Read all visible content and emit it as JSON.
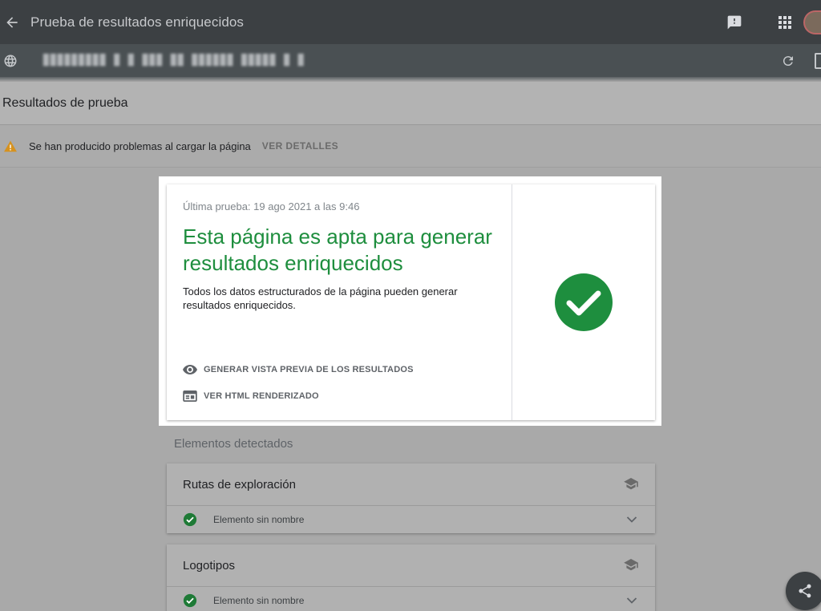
{
  "app": {
    "title": "Prueba de resultados enriquecidos",
    "url": "▉▉▉▉▉▉▉▉▉ ▉ ▉ ▉▉▉ ▉▉ ▉▉▉▉▉▉ ▉▉▉▉▉ ▉ ▉"
  },
  "results": {
    "header": "Resultados de prueba",
    "warning_text": "Se han producido problemas al cargar la página",
    "warning_link": "VER DETALLES"
  },
  "summary": {
    "date": "Última prueba: 19 ago 2021 a las 9:46",
    "headline": "Esta página es apta para generar resultados enriquecidos",
    "description": "Todos los datos estructurados de la página pueden generar resultados enriquecidos.",
    "preview_label": "GENERAR VISTA PREVIA DE LOS RESULTADOS",
    "html_label": "VER HTML RENDERIZADO",
    "status_color": "#1e8e3e"
  },
  "detected": {
    "title": "Elementos detectados",
    "items": [
      {
        "name": "Rutas de exploración",
        "row_label": "Elemento sin nombre"
      },
      {
        "name": "Logotipos",
        "row_label": "Elemento sin nombre"
      }
    ]
  },
  "icons": {
    "back": "arrow-back-icon",
    "feedback": "feedback-icon",
    "apps": "apps-grid-icon",
    "globe": "globe-icon",
    "reload": "reload-icon",
    "warning": "warning-triangle-icon",
    "preview": "eye-icon",
    "html": "web-window-icon",
    "check": "check-circle-icon",
    "rich": "school-cap-icon",
    "share": "share-icon"
  }
}
